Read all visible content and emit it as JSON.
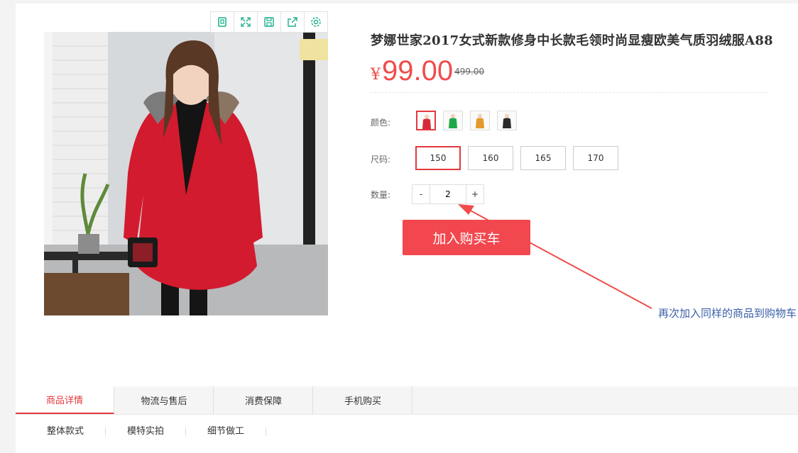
{
  "toolbar": {
    "icons": [
      "clipboard-icon",
      "fullscreen-icon",
      "save-icon",
      "share-icon",
      "settings-icon"
    ],
    "accent": "#1aad8c"
  },
  "product": {
    "title": "梦娜世家2017女式新款修身中长款毛领时尚显瘦欧美气质羽绒服A88",
    "currency": "¥",
    "price": "99.00",
    "old_price": "499.00",
    "image_alt": "woman in red hooded down coat with fur collar"
  },
  "options": {
    "color_label": "颜色:",
    "colors": [
      {
        "name": "red",
        "hex": "#d62a3a",
        "selected": true
      },
      {
        "name": "green",
        "hex": "#1fa84a",
        "selected": false
      },
      {
        "name": "orange",
        "hex": "#e69a2b",
        "selected": false
      },
      {
        "name": "black",
        "hex": "#2b2b2b",
        "selected": false
      }
    ],
    "size_label": "尺码:",
    "sizes": [
      "150",
      "160",
      "165",
      "170"
    ],
    "selected_size": "150",
    "qty_label": "数量:",
    "qty_minus": "-",
    "qty_value": "2",
    "qty_plus": "+"
  },
  "cart": {
    "add_label": "加入购买车"
  },
  "annotation": {
    "text": "再次加入同样的商品到购物车",
    "color": "#f04c4c"
  },
  "tabs": [
    {
      "label": "商品详情",
      "active": true
    },
    {
      "label": "物流与售后",
      "active": false
    },
    {
      "label": "消费保障",
      "active": false
    },
    {
      "label": "手机购买",
      "active": false
    }
  ],
  "subnav": [
    "整体款式",
    "模特实拍",
    "细节做工"
  ],
  "colors": {
    "brand_red": "#f2474e",
    "accent_red": "#e4393c",
    "annotation_blue": "#3a5fa8"
  }
}
